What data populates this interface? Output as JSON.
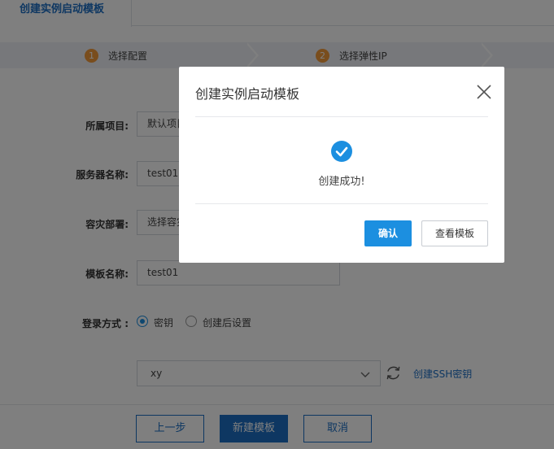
{
  "tabs": {
    "active_label": "创建实例启动模板"
  },
  "steps": [
    {
      "num": "1",
      "label": "选择配置"
    },
    {
      "num": "2",
      "label": "选择弹性IP"
    }
  ],
  "form": {
    "project_label": "所属项目:",
    "project_value": "默认项目",
    "server_name_label": "服务器名称:",
    "server_name_value": "test01",
    "disaster_label": "容灾部署:",
    "disaster_value": "选择容灾",
    "template_name_label": "模板名称:",
    "template_name_value": "test01",
    "login_label": "登录方式 :",
    "login_option_key": "密钥",
    "login_option_later": "创建后设置",
    "key_select_value": "xy",
    "create_ssh_link": "创建SSH密钥"
  },
  "footer": {
    "prev_label": "上一步",
    "create_label": "新建模板",
    "cancel_label": "取消"
  },
  "modal": {
    "title": "创建实例启动模板",
    "message": "创建成功!",
    "confirm_label": "确认",
    "view_label": "查看模板"
  },
  "colors": {
    "brand_blue": "#1c6fc4",
    "accent_blue": "#1c8fe0",
    "step_orange": "#f39a3b"
  }
}
